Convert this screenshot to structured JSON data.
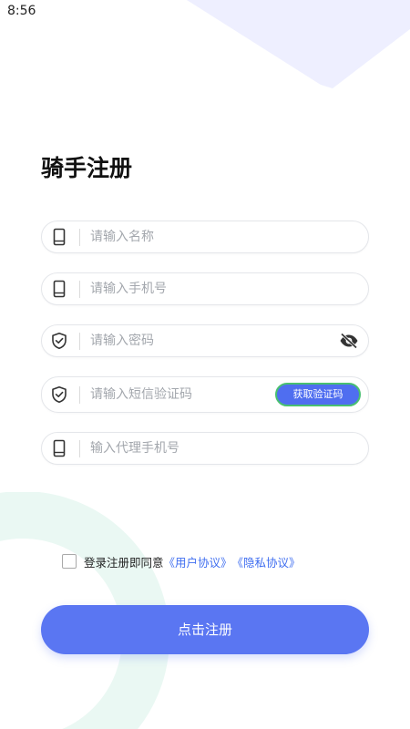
{
  "status_bar": {
    "time": "8:56"
  },
  "page": {
    "title": "骑手注册"
  },
  "form": {
    "name_placeholder": "请输入名称",
    "phone_placeholder": "请输入手机号",
    "password_placeholder": "请输入密码",
    "sms_code_placeholder": "请输入短信验证码",
    "get_code_label": "获取验证码",
    "agent_phone_placeholder": "输入代理手机号"
  },
  "agreement": {
    "prefix": "登录注册即同意",
    "user_agreement": "《用户协议》",
    "privacy_agreement": "《隐私协议》",
    "checked": false
  },
  "submit_label": "点击注册",
  "colors": {
    "primary": "#5a76f2",
    "link": "#3f6ef0",
    "code_button_border": "#49c071",
    "decoration_top": "#eeefff",
    "decoration_ring": "#eaf8f3"
  },
  "icons": {
    "name_field": "phone-icon",
    "phone_field": "phone-icon",
    "password_field": "shield-check-icon",
    "password_toggle": "eye-off-icon",
    "sms_field": "shield-check-icon",
    "agent_field": "phone-icon"
  }
}
